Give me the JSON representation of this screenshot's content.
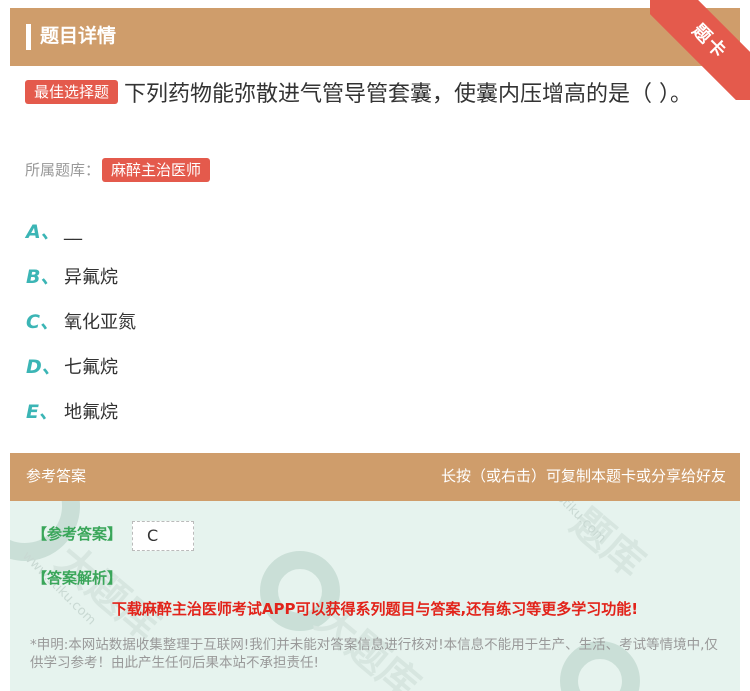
{
  "header": {
    "title": "题目详情"
  },
  "ribbon": {
    "label": "题卡"
  },
  "question": {
    "type_tag": "最佳选择题",
    "text": "下列药物能弥散进气管导管套囊，使囊内压增高的是（ ）。"
  },
  "bank": {
    "label": "所属题库：",
    "tag": "麻醉主治医师"
  },
  "options": [
    {
      "letter": "A、",
      "text": "__"
    },
    {
      "letter": "B、",
      "text": "异氟烷"
    },
    {
      "letter": "C、",
      "text": "氧化亚氮"
    },
    {
      "letter": "D、",
      "text": "七氟烷"
    },
    {
      "letter": "E、",
      "text": "地氟烷"
    }
  ],
  "answer_section": {
    "title": "参考答案",
    "hint": "长按（或右击）可复制本题卡或分享给好友",
    "ref_label": "【参考答案】",
    "ref_value": "C",
    "analysis_label": "【答案解析】",
    "promo": "下载麻醉主治医师考试APP可以获得系列题目与答案,还有练习等更多学习功能!",
    "disclaimer": "*申明:本网站数据收集整理于互联网!我们并未能对答案信息进行核对!本信息不能用于生产、生活、考试等情境中,仅供学习参考！由此产生任何后果本站不承担责任!"
  },
  "colors": {
    "header_bg": "#cf9d6b",
    "accent_red": "#e45a4c",
    "option_letter": "#3bb5b5",
    "answer_green": "#3aa65a",
    "promo_red": "#e2231a",
    "answer_bg": "#e6f3ee"
  }
}
